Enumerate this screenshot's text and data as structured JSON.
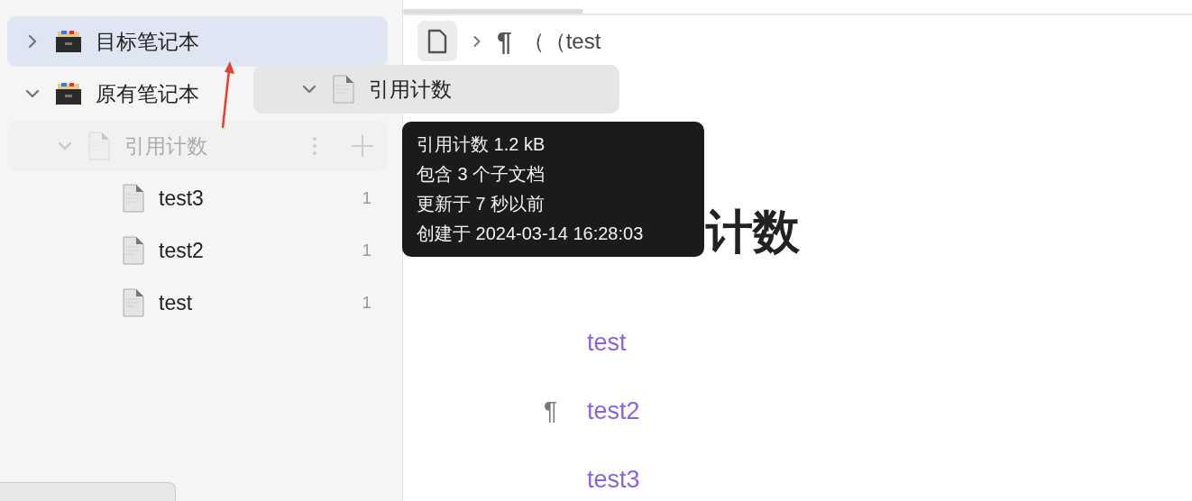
{
  "sidebar": {
    "notebooks": [
      {
        "name": "目标笔记本",
        "expanded": false,
        "selected": true
      },
      {
        "name": "原有笔记本",
        "expanded": true,
        "selected": false,
        "children": [
          {
            "name": "引用计数",
            "expanded": true,
            "dragging": true,
            "children": [
              {
                "name": "test3",
                "count": "1"
              },
              {
                "name": "test2",
                "count": "1"
              },
              {
                "name": "test",
                "count": "1"
              }
            ]
          }
        ]
      }
    ]
  },
  "drag_ghost": {
    "name": "引用计数",
    "expanded": true
  },
  "breadcrumb": {
    "pilcrow": "¶",
    "text": "（（test"
  },
  "tooltip": {
    "lines": [
      "引用计数 1.2 kB",
      "包含 3 个子文档",
      "更新于 7 秒以前",
      "创建于 2024-03-14 16:28:03"
    ]
  },
  "document": {
    "title": "计数",
    "links": [
      {
        "text": "test"
      },
      {
        "text": "test2",
        "marker": "¶"
      },
      {
        "text": "test3"
      }
    ]
  }
}
